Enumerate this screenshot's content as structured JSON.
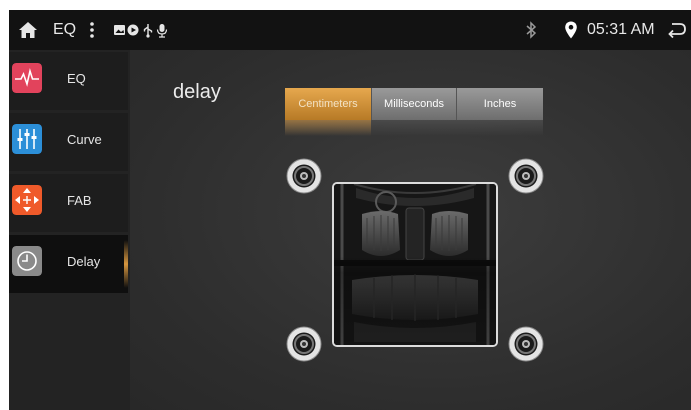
{
  "status_bar": {
    "title": "EQ",
    "time": "05:31 AM",
    "icons": [
      "home-icon",
      "more-vert-icon",
      "image-icon",
      "circle-play-icon",
      "usb-icon",
      "mic-icon",
      "bluetooth-icon",
      "location-icon",
      "back-icon"
    ]
  },
  "sidebar": {
    "items": [
      {
        "label": "EQ",
        "icon": "waveform-icon",
        "color": "#e2435c"
      },
      {
        "label": "Curve",
        "icon": "sliders-icon",
        "color": "#2c8fd8"
      },
      {
        "label": "FAB",
        "icon": "fade-balance-icon",
        "color": "#ef5a2a"
      },
      {
        "label": "Delay",
        "icon": "clock-icon",
        "color": "#8a8a8a",
        "selected": true
      }
    ]
  },
  "main": {
    "title": "delay",
    "unit_tabs": [
      {
        "label": "Centimeters",
        "selected": true
      },
      {
        "label": "Milliseconds",
        "selected": false
      },
      {
        "label": "Inches",
        "selected": false
      }
    ],
    "speakers": [
      "front-left-speaker",
      "front-right-speaker",
      "rear-left-speaker",
      "rear-right-speaker"
    ]
  },
  "colors": {
    "accent": "#d6963f",
    "statusbar": "#121212",
    "background": "#2f2f2f"
  }
}
